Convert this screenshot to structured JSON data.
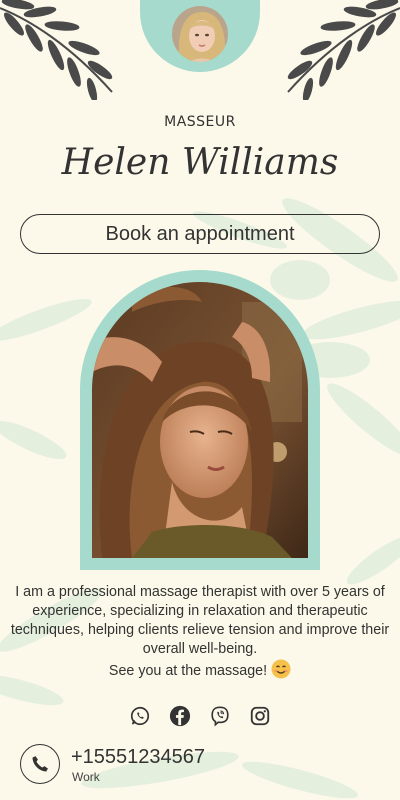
{
  "profile": {
    "role": "MASSEUR",
    "name": "Helen Williams",
    "avatar": "avatar-portrait"
  },
  "booking": {
    "label": "Book an appointment"
  },
  "hero": {
    "image": "head-massage-photo"
  },
  "bio": {
    "text": "I am a professional massage therapist with over 5 years of experience, specializing in relaxation and therapeutic techniques, helping clients relieve tension and improve their overall well-being.",
    "closing": "See you at the massage!",
    "emoji": "smiling-face-emoji"
  },
  "socials": [
    {
      "icon": "whatsapp-icon"
    },
    {
      "icon": "facebook-icon"
    },
    {
      "icon": "viber-icon"
    },
    {
      "icon": "instagram-icon"
    }
  ],
  "contact": {
    "phone": "+15551234567",
    "label": "Work",
    "icon": "phone-icon"
  },
  "colors": {
    "background": "#fcf9ea",
    "accent": "#a6dacc",
    "text": "#333333",
    "branch": "#4a4a4a"
  }
}
